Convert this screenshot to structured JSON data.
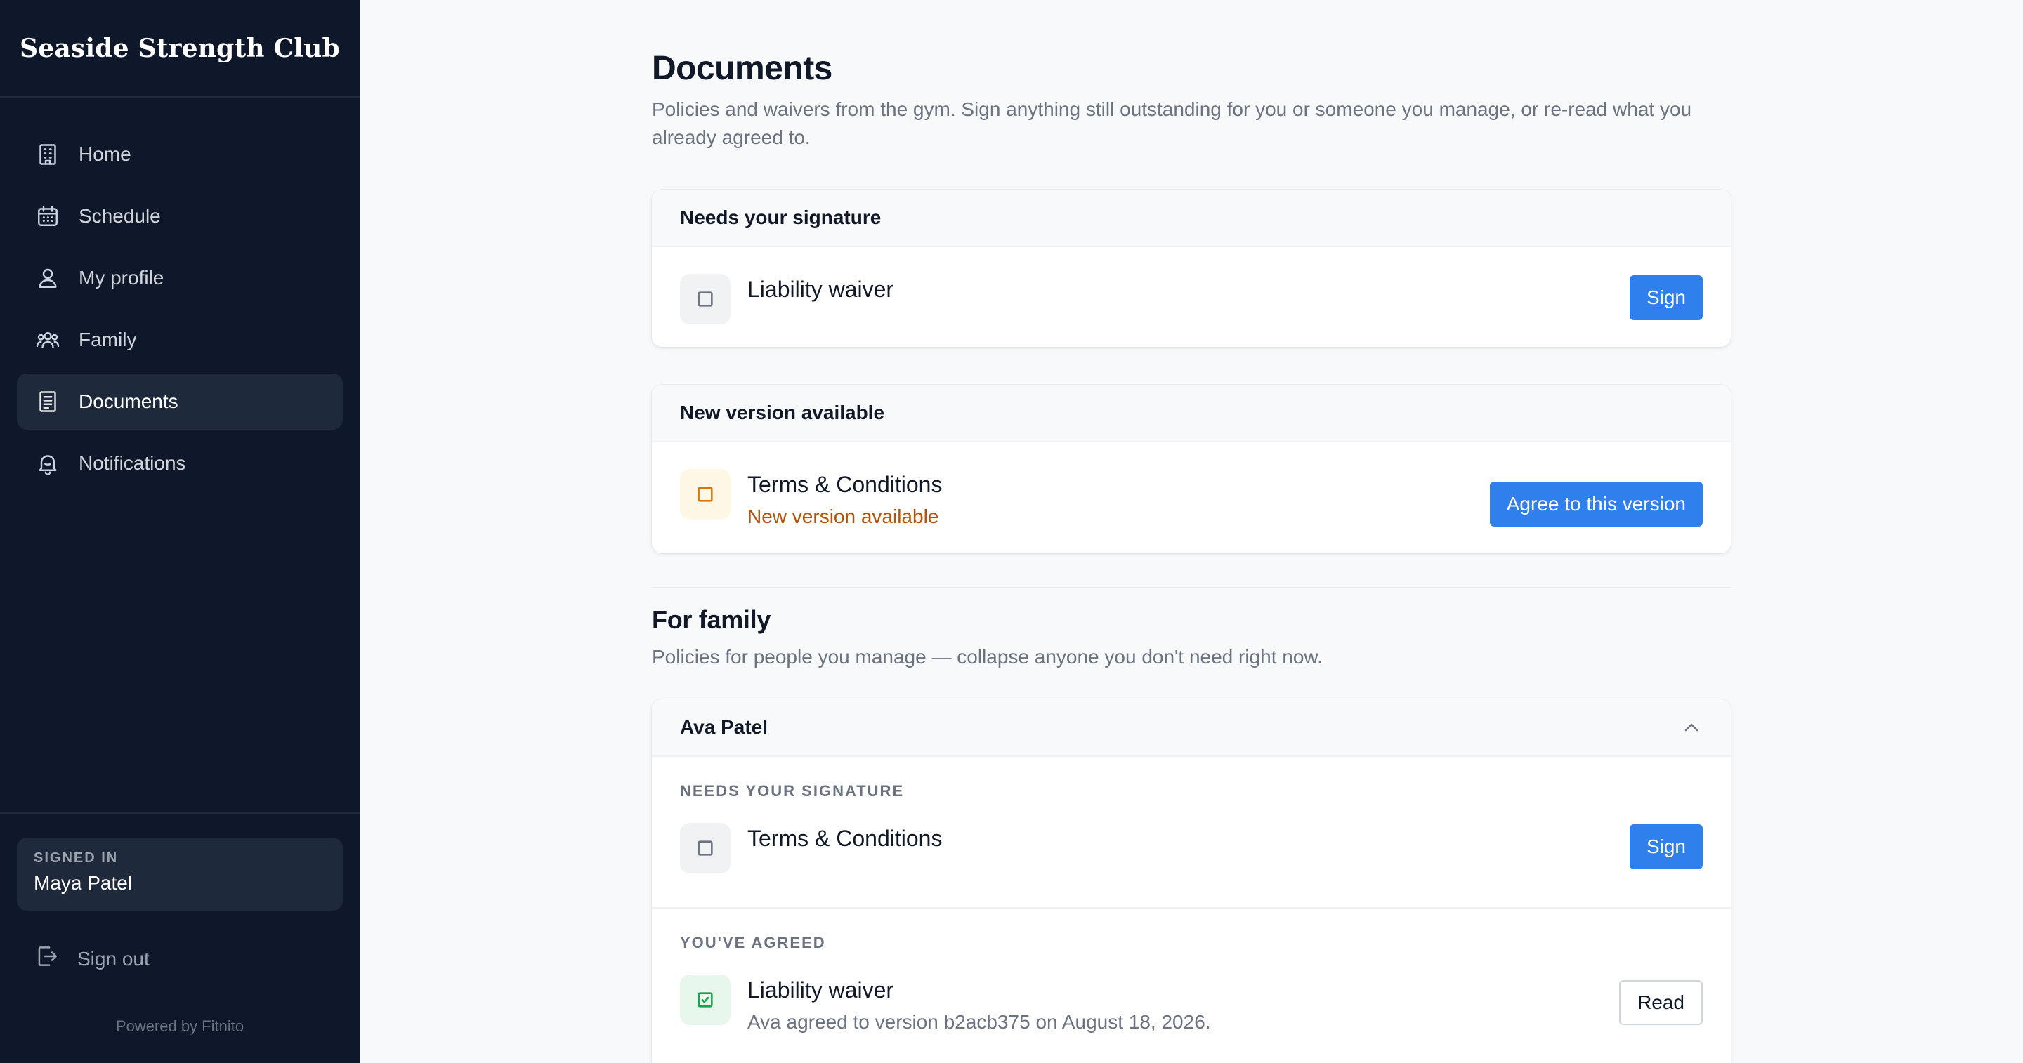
{
  "brand": {
    "name": "Seaside Strength Club"
  },
  "sidebar": {
    "items": [
      {
        "label": "Home",
        "icon": "building-icon"
      },
      {
        "label": "Schedule",
        "icon": "calendar-icon"
      },
      {
        "label": "My profile",
        "icon": "user-icon"
      },
      {
        "label": "Family",
        "icon": "users-icon"
      },
      {
        "label": "Documents",
        "icon": "document-icon",
        "active": true
      },
      {
        "label": "Notifications",
        "icon": "bell-icon"
      }
    ],
    "signed_in_label": "SIGNED IN",
    "user_name": "Maya Patel",
    "sign_out_label": "Sign out",
    "powered_by": "Powered by Fitnito"
  },
  "page": {
    "title": "Documents",
    "description": "Policies and waivers from the gym. Sign anything still outstanding for you or someone you manage, or re-read what you already agreed to."
  },
  "needs_signature": {
    "heading": "Needs your signature",
    "doc_title": "Liability waiver",
    "button": "Sign"
  },
  "new_version": {
    "heading": "New version available",
    "doc_title": "Terms & Conditions",
    "doc_status": "New version available",
    "button": "Agree to this version"
  },
  "family": {
    "title": "For family",
    "description": "Policies for people you manage — collapse anyone you don't need right now.",
    "member": {
      "name": "Ava Patel",
      "needs_heading": "NEEDS YOUR SIGNATURE",
      "needs_doc_title": "Terms & Conditions",
      "needs_button": "Sign",
      "agreed_heading": "YOU'VE AGREED",
      "agreed_doc_title": "Liability waiver",
      "agreed_doc_detail": "Ava agreed to version b2acb375 on August 18, 2026.",
      "agreed_button": "Read"
    }
  },
  "colors": {
    "sidebar_bg": "#0f172a",
    "accent": "#2f80ed",
    "warning": "#b45309",
    "success": "#16a34a"
  }
}
